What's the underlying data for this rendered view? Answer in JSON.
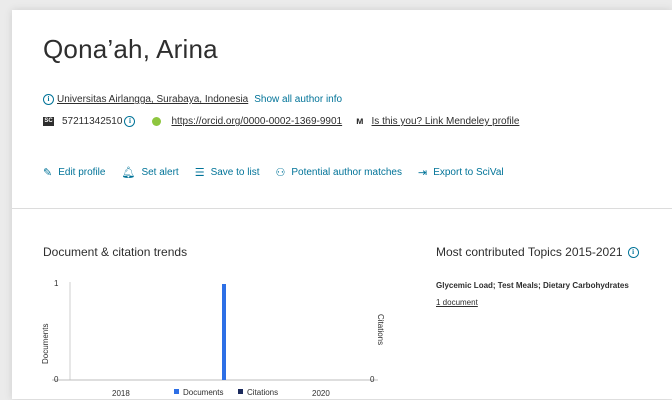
{
  "profile": {
    "name": "Qona’ah, Arina",
    "affiliation": "Universitas Airlangga, Surabaya, Indonesia",
    "show_all_info": "Show all author info",
    "scopus_id": "57211342510",
    "orcid_url": "https://orcid.org/0000-0002-1369-9901",
    "mendeley_link": "Is this you? Link Mendeley profile"
  },
  "toolbar": {
    "edit_profile": "Edit profile",
    "set_alert": "Set alert",
    "save_to_list": "Save to list",
    "potential_matches": "Potential author matches",
    "export_scival": "Export to SciVal"
  },
  "trends": {
    "title": "Document & citation trends"
  },
  "topics": {
    "title": "Most contributed Topics 2015-2021",
    "items": [
      {
        "name": "Glycemic Load; Test Meals; Dietary Carbohydrates",
        "count": "1 document"
      }
    ]
  },
  "chart_data": {
    "type": "bar",
    "x_ticks": [
      "2018",
      "2020"
    ],
    "series": [
      {
        "name": "Documents",
        "color": "#2d6fe6",
        "points": [
          {
            "x": 2019,
            "y": 1
          }
        ]
      },
      {
        "name": "Citations",
        "color": "#1b2a5c",
        "points": []
      }
    ],
    "ylabel_left": "Documents",
    "ylabel_right": "Citations",
    "left_ticks": [
      "0",
      "1"
    ],
    "right_ticks": [
      "0"
    ],
    "ylim": [
      0,
      1
    ],
    "xlim": [
      2017,
      2021
    ],
    "legend": [
      "Documents",
      "Citations"
    ]
  },
  "colors": {
    "accent": "#007398",
    "documents_bar": "#2d6fe6",
    "citations_legend": "#1b2a5c"
  }
}
